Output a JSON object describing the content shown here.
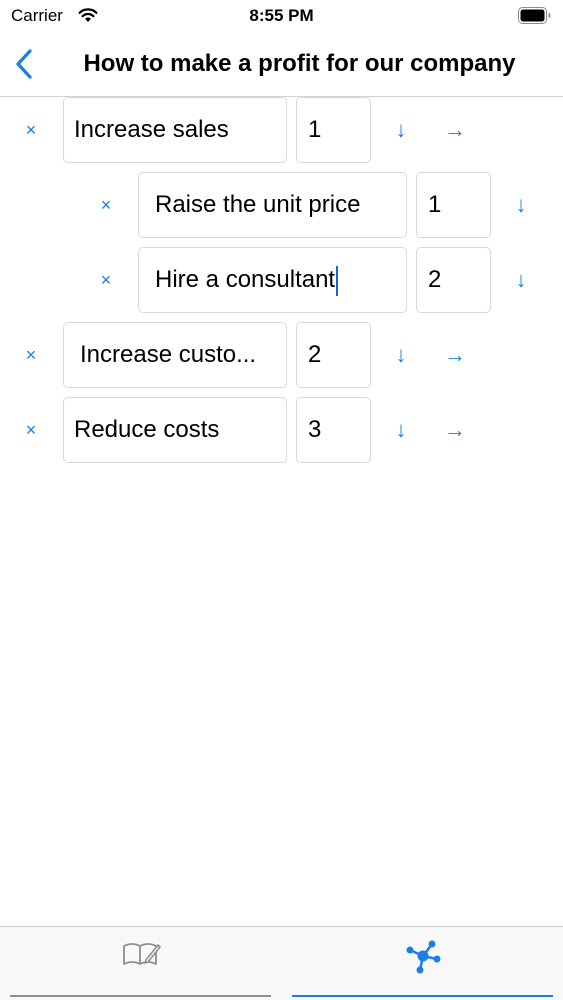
{
  "status_bar": {
    "carrier": "Carrier",
    "time": "8:55 PM"
  },
  "nav": {
    "title": "How to make a profit for our company",
    "back_icon": "chevron-left-icon"
  },
  "items": [
    {
      "text": "Increase sales",
      "number": "1",
      "level": 0,
      "delete_symbol": "×",
      "down_symbol": "↓",
      "right_symbol": "→"
    },
    {
      "text": "Raise the unit price",
      "number": "1",
      "level": 1,
      "delete_symbol": "×",
      "down_symbol": "↓"
    },
    {
      "text": "Hire a consultant",
      "number": "2",
      "level": 1,
      "delete_symbol": "×",
      "down_symbol": "↓",
      "focused": true
    },
    {
      "text": "Increase custo...",
      "number": "2",
      "level": 0,
      "delete_symbol": "×",
      "down_symbol": "↓",
      "right_symbol": "→"
    },
    {
      "text": "Reduce costs",
      "number": "3",
      "level": 0,
      "delete_symbol": "×",
      "down_symbol": "↓",
      "right_symbol": "→"
    }
  ],
  "tab_bar": {
    "tabs": [
      {
        "icon": "book-edit-icon",
        "selected": false
      },
      {
        "icon": "network-graph-icon",
        "selected": true
      }
    ]
  },
  "colors": {
    "accent": "#1a7ee6",
    "icon_gray": "#8e8e93",
    "border": "#d9d9d9"
  }
}
